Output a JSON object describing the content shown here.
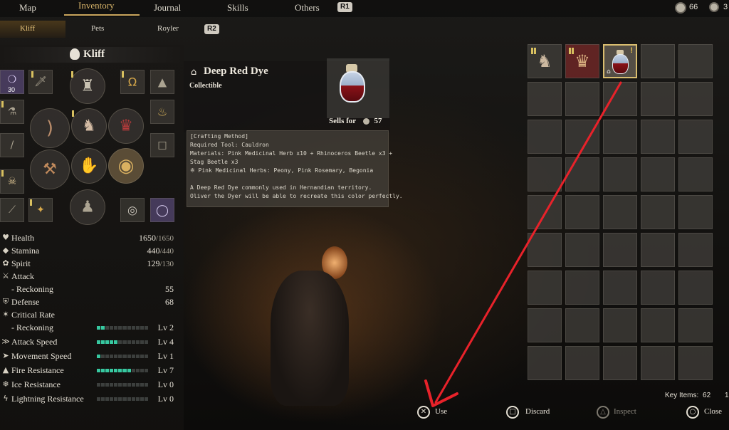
{
  "colors": {
    "accent_gold": "#c9a55c",
    "level_fill": "#37c8a0",
    "arrow_red": "#e8222a"
  },
  "nav": {
    "tabs": [
      {
        "label": "Map"
      },
      {
        "label": "Inventory",
        "active": true
      },
      {
        "label": "Journal"
      },
      {
        "label": "Skills"
      },
      {
        "label": "Others"
      }
    ],
    "next_button": "R1",
    "currency": {
      "icon": "coin-icon",
      "value": "66",
      "cut_value": "3"
    }
  },
  "subnav": {
    "tabs": [
      {
        "label": "Kliff",
        "active": true
      },
      {
        "label": "Pets"
      },
      {
        "label": "Royler"
      }
    ],
    "next_button": "R2"
  },
  "character": {
    "name": "Kliff",
    "badge_count": "30",
    "stats": [
      {
        "label": "Health",
        "icon": "heart-icon",
        "value": "1650",
        "max": "/1650"
      },
      {
        "label": "Stamina",
        "icon": "stamina-icon",
        "value": "440",
        "max": "/440"
      },
      {
        "label": "Spirit",
        "icon": "spirit-icon",
        "value": "129",
        "max": "/130"
      },
      {
        "label": "Attack",
        "icon": "sword-icon",
        "value": "",
        "max": ""
      },
      {
        "label": "- Reckoning",
        "icon": "",
        "value": "55",
        "max": ""
      },
      {
        "label": "Defense",
        "icon": "shield-icon",
        "value": "68",
        "max": ""
      },
      {
        "label": "Critical Rate",
        "icon": "critical-icon",
        "value": "",
        "max": ""
      },
      {
        "label": "- Reckoning",
        "icon": "",
        "value": "Lv 2",
        "max": "",
        "level": 0.2
      },
      {
        "label": "Attack Speed",
        "icon": "attack-speed-icon",
        "value": "Lv 4",
        "max": "",
        "level": 0.4
      },
      {
        "label": "Movement Speed",
        "icon": "movement-icon",
        "value": "Lv 1",
        "max": "",
        "level": 0.1
      },
      {
        "label": "Fire Resistance",
        "icon": "fire-icon",
        "value": "Lv 7",
        "max": "",
        "level": 0.7
      },
      {
        "label": "Ice Resistance",
        "icon": "ice-icon",
        "value": "Lv 0",
        "max": "",
        "level": 0
      },
      {
        "label": "Lightning Resistance",
        "icon": "lightning-icon",
        "value": "Lv 0",
        "max": "",
        "level": 0
      }
    ]
  },
  "item": {
    "name": "Deep Red Dye",
    "category": "Collectible",
    "sells_label": "Sells for",
    "sells_value": "57",
    "description_lines": [
      "[Crafting Method]",
      "Required Tool: Cauldron",
      "Materials: Pink Medicinal Herb x10 + Rhinoceros Beetle x3 +",
      "Stag Beetle x3",
      "※ Pink Medicinal Herbs: Peony, Pink Rosemary, Begonia",
      "",
      "A Deep Red Dye commonly used in Hernandian territory.",
      "Oliver the Dyer will be able to recreate this color perfectly."
    ]
  },
  "inventory": {
    "slots": [
      {
        "icon": "armor-icon",
        "pips": true
      },
      {
        "icon": "crimson-armor-icon",
        "pips": true
      },
      {
        "icon": "dye-bottle-icon",
        "selected": true,
        "new": true,
        "home": true
      }
    ],
    "key_items_label": "Key Items:",
    "key_items_value": "62",
    "cut_value": "1"
  },
  "controls": [
    {
      "label": "Use",
      "button": "cross-button"
    },
    {
      "label": "Discard",
      "button": "square-button"
    },
    {
      "label": "Inspect",
      "button": "triangle-button",
      "disabled": true
    },
    {
      "label": "Close",
      "button": "circle-button"
    }
  ]
}
